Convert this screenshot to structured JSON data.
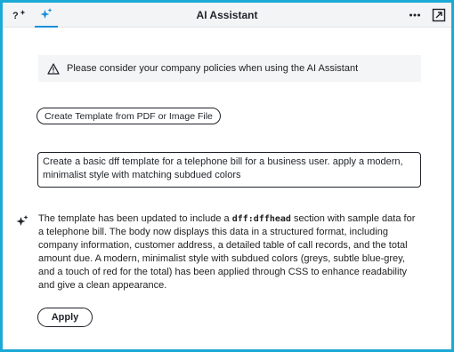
{
  "header": {
    "title": "AI Assistant",
    "help_tab_icon": "help-sparkle-icon",
    "ai_tab_icon": "sparkle-icon",
    "more_icon": "more-icon",
    "popout_icon": "pop-out-icon"
  },
  "notice": {
    "text": "Please consider your company policies when using the AI Assistant"
  },
  "suggestion": {
    "label": "Create Template from PDF or Image File"
  },
  "prompt": {
    "text": "Create a basic dff template for a telephone bill for a business user. apply a modern, minimalist style with matching subdued colors"
  },
  "response": {
    "before": "The template has been updated to include a ",
    "code": "dff:dffhead",
    "after": " section with sample data for a telephone bill. The body now displays this data in a structured format, including company information, customer address, a detailed table of call records, and the total amount due. A modern, minimalist style with subdued colors (greys, subtle blue-grey, and a touch of red for the total) has been applied through CSS to enhance readability and give a clean appearance."
  },
  "actions": {
    "apply_label": "Apply"
  },
  "colors": {
    "frame": "#1ba9d6",
    "accent": "#1a8fd9",
    "header_bg": "#f3f4f6",
    "notice_bg": "#f4f5f7"
  }
}
